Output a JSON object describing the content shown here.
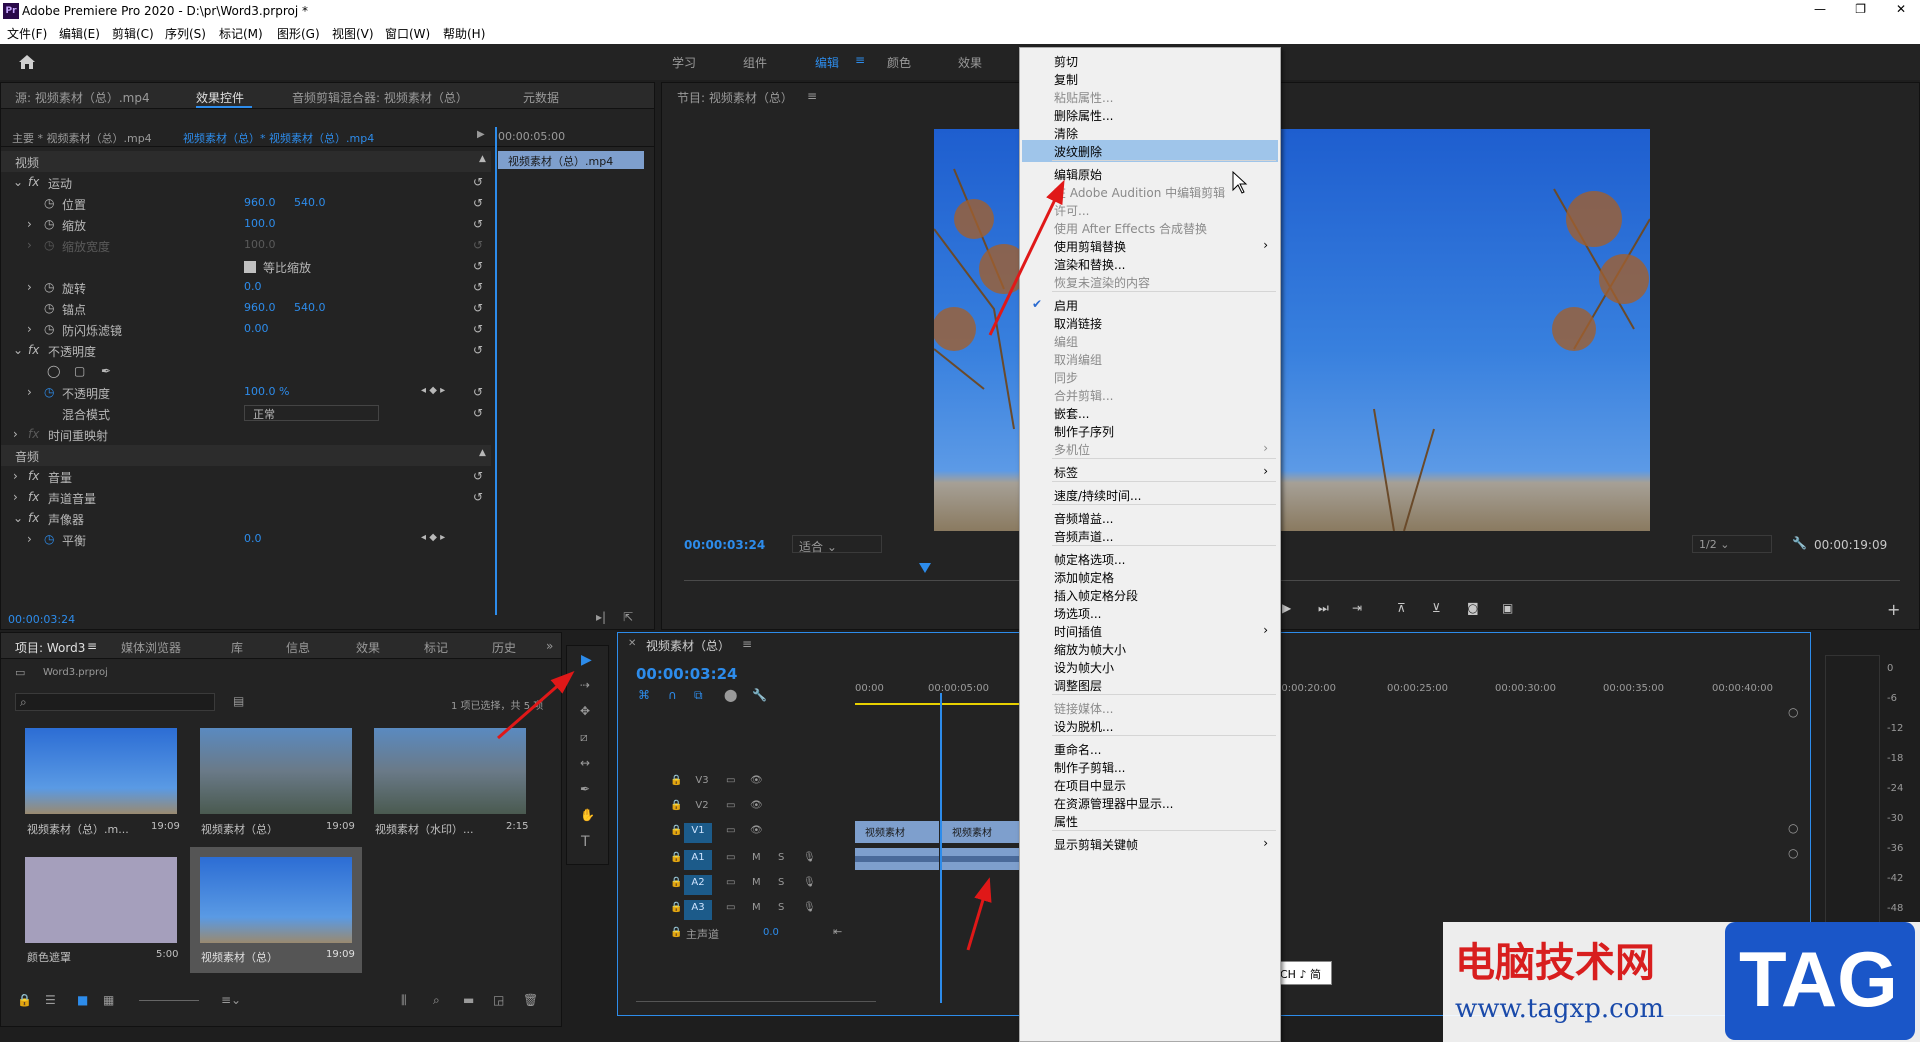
{
  "app": {
    "title": "Adobe Premiere Pro 2020 - D:\\pr\\Word3.prproj *",
    "logo": "Pr",
    "window_controls": [
      "—",
      "❐",
      "✕"
    ]
  },
  "menu": [
    "文件(F)",
    "编辑(E)",
    "剪辑(C)",
    "序列(S)",
    "标记(M)",
    "图形(G)",
    "视图(V)",
    "窗口(W)",
    "帮助(H)"
  ],
  "workspaces": [
    "学习",
    "组件",
    "编辑",
    "颜色",
    "效果"
  ],
  "effect_panel": {
    "tabs": [
      "源: 视频素材（总）.mp4",
      "效果控件",
      "音频剪辑混合器: 视频素材（总）",
      "元数据"
    ],
    "master": "主要 * 视频素材（总）.mp4",
    "clip": "视频素材（总）* 视频素材（总）.mp4",
    "tc_ruler": "00:00:05:00",
    "mini_clip": "视频素材（总）.mp4",
    "section_video": "视频",
    "motion": "运动",
    "position": "位置",
    "position_x": "960.0",
    "position_y": "540.0",
    "scale": "缩放",
    "scale_val": "100.0",
    "scale_w": "缩放宽度",
    "scale_w_val": "100.0",
    "uniform": "等比缩放",
    "rotation": "旋转",
    "rotation_val": "0.0",
    "anchor": "锚点",
    "anchor_x": "960.0",
    "anchor_y": "540.0",
    "flicker": "防闪烁滤镜",
    "flicker_val": "0.00",
    "opacity_group": "不透明度",
    "opacity": "不透明度",
    "opacity_val": "100.0 %",
    "blend": "混合模式",
    "blend_val": "正常",
    "time_remap": "时间重映射",
    "section_audio": "音频",
    "volume": "音量",
    "channel_vol": "声道音量",
    "panner": "声像器",
    "balance": "平衡",
    "balance_val": "0.0",
    "timecode": "00:00:03:24"
  },
  "program": {
    "title": "节目: 视频素材（总）",
    "timecode": "00:00:03:24",
    "fit": "适合",
    "quality": "1/2",
    "duration": "00:00:19:09"
  },
  "project": {
    "tabs": [
      "项目: Word3",
      "媒体浏览器",
      "库",
      "信息",
      "效果",
      "标记",
      "历史"
    ],
    "file": "Word3.prproj",
    "selection": "1 项已选择，共 5 项",
    "items": [
      {
        "name": "视频素材（总）.m...",
        "dur": "19:09"
      },
      {
        "name": "视频素材（总）",
        "dur": "19:09"
      },
      {
        "name": "视频素材（水印）...",
        "dur": "2:15"
      },
      {
        "name": "颜色遮罩",
        "dur": "5:00"
      },
      {
        "name": "视频素材（总）",
        "dur": "19:09"
      }
    ]
  },
  "timeline": {
    "title": "视频素材（总）",
    "timecode": "00:00:03:24",
    "ruler": [
      "00:00",
      "00:00:05:00",
      "00:00:20:00",
      "00:00:25:00",
      "00:00:30:00",
      "00:00:35:00",
      "00:00:40:00"
    ],
    "video_tracks": [
      "V3",
      "V2",
      "V1"
    ],
    "audio_tracks": [
      "A1",
      "A2",
      "A3"
    ],
    "master": "主声道",
    "master_val": "0.0",
    "clip_label": "视频素材",
    "mute": "M",
    "solo": "S"
  },
  "meter": [
    "0",
    "-6",
    "-12",
    "-18",
    "-24",
    "-30",
    "-36",
    "-42",
    "-48"
  ],
  "ime": "CH ♪ 简",
  "context_menu": [
    {
      "label": "剪切",
      "enabled": true
    },
    {
      "label": "复制",
      "enabled": true
    },
    {
      "label": "粘贴属性...",
      "enabled": false
    },
    {
      "label": "删除属性...",
      "enabled": true
    },
    {
      "label": "清除",
      "enabled": true
    },
    {
      "label": "波纹删除",
      "enabled": true,
      "highlight": true
    },
    {
      "sep": true
    },
    {
      "label": "编辑原始",
      "enabled": true
    },
    {
      "label": "在 Adobe Audition 中编辑剪辑",
      "enabled": false
    },
    {
      "label": "许可...",
      "enabled": false
    },
    {
      "label": "使用 After Effects 合成替换",
      "enabled": false
    },
    {
      "label": "使用剪辑替换",
      "enabled": true,
      "sub": true
    },
    {
      "label": "渲染和替换...",
      "enabled": true
    },
    {
      "label": "恢复未渲染的内容",
      "enabled": false
    },
    {
      "sep": true
    },
    {
      "label": "启用",
      "enabled": true,
      "check": true
    },
    {
      "label": "取消链接",
      "enabled": true
    },
    {
      "label": "编组",
      "enabled": false
    },
    {
      "label": "取消编组",
      "enabled": false
    },
    {
      "label": "同步",
      "enabled": false
    },
    {
      "label": "合并剪辑...",
      "enabled": false
    },
    {
      "label": "嵌套...",
      "enabled": true
    },
    {
      "label": "制作子序列",
      "enabled": true
    },
    {
      "label": "多机位",
      "enabled": false,
      "sub": true
    },
    {
      "sep": true
    },
    {
      "label": "标签",
      "enabled": true,
      "sub": true
    },
    {
      "sep": true
    },
    {
      "label": "速度/持续时间...",
      "enabled": true
    },
    {
      "sep": true
    },
    {
      "label": "音频增益...",
      "enabled": true
    },
    {
      "label": "音频声道...",
      "enabled": true
    },
    {
      "sep": true
    },
    {
      "label": "帧定格选项...",
      "enabled": true
    },
    {
      "label": "添加帧定格",
      "enabled": true
    },
    {
      "label": "插入帧定格分段",
      "enabled": true
    },
    {
      "label": "场选项...",
      "enabled": true
    },
    {
      "label": "时间插值",
      "enabled": true,
      "sub": true
    },
    {
      "label": "缩放为帧大小",
      "enabled": true
    },
    {
      "label": "设为帧大小",
      "enabled": true
    },
    {
      "label": "调整图层",
      "enabled": true
    },
    {
      "sep": true
    },
    {
      "label": "链接媒体...",
      "enabled": false
    },
    {
      "label": "设为脱机...",
      "enabled": true
    },
    {
      "sep": true
    },
    {
      "label": "重命名...",
      "enabled": true
    },
    {
      "label": "制作子剪辑...",
      "enabled": true
    },
    {
      "label": "在项目中显示",
      "enabled": true
    },
    {
      "label": "在资源管理器中显示...",
      "enabled": true
    },
    {
      "label": "属性",
      "enabled": true
    },
    {
      "sep": true
    },
    {
      "label": "显示剪辑关键帧",
      "enabled": true,
      "sub": true
    }
  ],
  "watermark": {
    "title": "电脑技术网",
    "url": "www.tagxp.com",
    "tag": "TAG"
  },
  "colors": {
    "accent": "#2d8ceb",
    "highlight": "#9fc5ea",
    "arrow": "#e01818",
    "clip_blue": "#7e9fcd"
  }
}
